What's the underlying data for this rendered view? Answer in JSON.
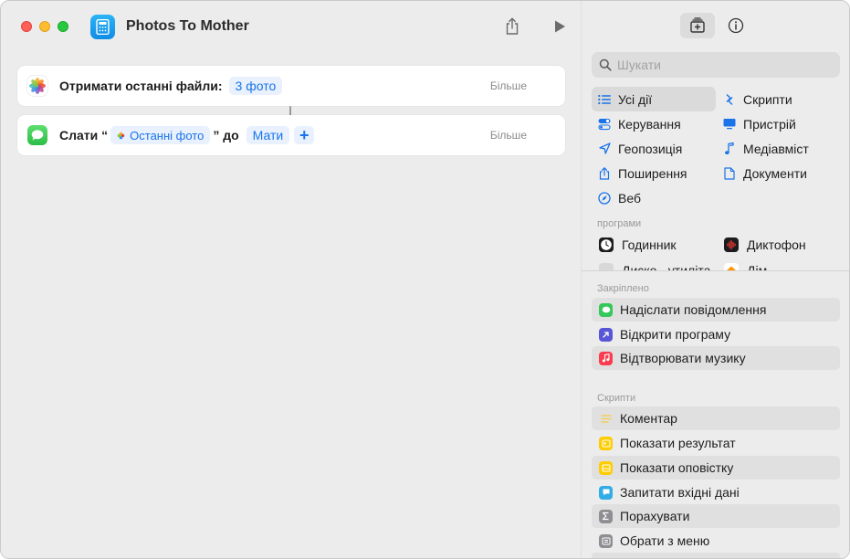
{
  "window": {
    "title": "Photos To Mother"
  },
  "editor": {
    "actions": [
      {
        "label": "Отримати останні файли:",
        "token": "3 фото",
        "more": "Більше"
      },
      {
        "label_prefix": "Слати “",
        "variable": "Останні фото",
        "label_mid": "” до",
        "recipient": "Мати",
        "add_symbol": "+",
        "more": "Більше"
      }
    ]
  },
  "sidebar": {
    "search": {
      "placeholder": "Шукати"
    },
    "categories": [
      {
        "label": "Усі дії",
        "icon": "list-icon",
        "selected": true
      },
      {
        "label": "Скрипти",
        "icon": "scripting-icon"
      },
      {
        "label": "Керування",
        "icon": "toggle-icon"
      },
      {
        "label": "Пристрій",
        "icon": "monitor-icon"
      },
      {
        "label": "Геопозиція",
        "icon": "location-arrow-icon"
      },
      {
        "label": "Медіавміст",
        "icon": "music-note-icon"
      },
      {
        "label": "Поширення",
        "icon": "share-icon"
      },
      {
        "label": "Документи",
        "icon": "document-icon"
      },
      {
        "label": "Веб",
        "icon": "compass-icon"
      }
    ],
    "apps_label": "програми",
    "apps": [
      {
        "label": "Годинник",
        "icon": "clock-app-icon"
      },
      {
        "label": "Диктофон",
        "icon": "voice-memos-icon"
      },
      {
        "label": "Диско - утиліта",
        "icon": "disk-utility-icon"
      },
      {
        "label": "Дім",
        "icon": "home-app-icon"
      }
    ],
    "pinned_label": "Закріплено",
    "pinned": [
      {
        "label": "Надіслати повідомлення",
        "icon": "messages-icon",
        "color": "#34c759"
      },
      {
        "label": "Відкрити програму",
        "icon": "open-app-icon",
        "color": "#5856d6"
      },
      {
        "label": "Відтворювати музику",
        "icon": "music-icon",
        "color": "#fa3c4f"
      }
    ],
    "scripts_label": "Скрипти",
    "scripts": [
      {
        "label": "Коментар",
        "icon": "comment-lines-icon",
        "color": "#f7c948"
      },
      {
        "label": "Показати результат",
        "icon": "show-result-icon",
        "color": "#ffcc00"
      },
      {
        "label": "Показати оповістку",
        "icon": "show-alert-icon",
        "color": "#ffcc00"
      },
      {
        "label": "Запитати вхідні дані",
        "icon": "ask-input-icon",
        "color": "#32ade6"
      },
      {
        "label": "Порахувати",
        "icon": "sigma-icon",
        "color": "#8e8e93"
      },
      {
        "label": "Обрати з меню",
        "icon": "menu-icon",
        "color": "#8e8e93"
      }
    ]
  },
  "colors": {
    "accent": "#1a73e8",
    "token_bg": "#e8f1fd"
  }
}
